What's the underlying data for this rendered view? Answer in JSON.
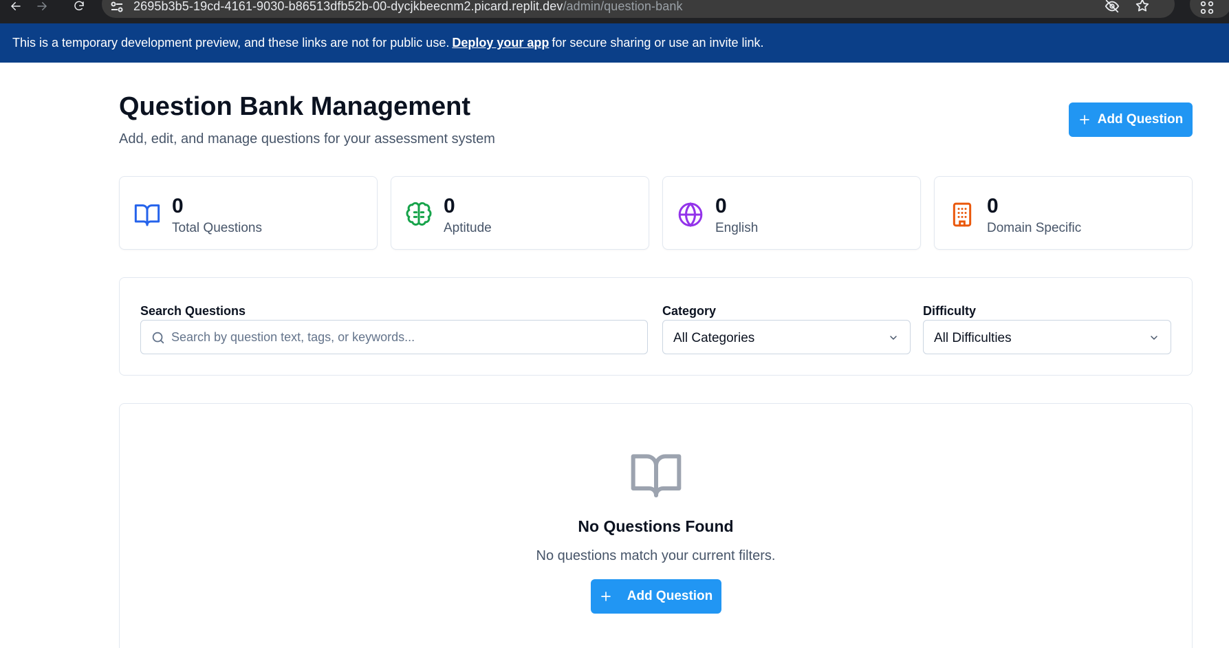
{
  "browser": {
    "url_host": "2695b3b5-19cd-4161-9030-b86513dfb52b-00-dycjkbeecnm2.picard.replit.dev",
    "url_path": "/admin/question-bank"
  },
  "banner": {
    "text_before": "This is a temporary development preview, and these links are not for public use.",
    "link_text": "Deploy your app",
    "text_after": "for secure sharing or use an invite link."
  },
  "header": {
    "title": "Question Bank Management",
    "subtitle": "Add, edit, and manage questions for your assessment system",
    "add_button_label": "Add Question"
  },
  "stats": [
    {
      "value": "0",
      "label": "Total Questions",
      "icon": "book-open-icon",
      "color": "#2563eb"
    },
    {
      "value": "0",
      "label": "Aptitude",
      "icon": "brain-icon",
      "color": "#16a34a"
    },
    {
      "value": "0",
      "label": "English",
      "icon": "globe-icon",
      "color": "#9333ea"
    },
    {
      "value": "0",
      "label": "Domain Specific",
      "icon": "building-icon",
      "color": "#ea580c"
    }
  ],
  "filters": {
    "search_label": "Search Questions",
    "search_placeholder": "Search by question text, tags, or keywords...",
    "category_label": "Category",
    "category_value": "All Categories",
    "difficulty_label": "Difficulty",
    "difficulty_value": "All Difficulties"
  },
  "empty_state": {
    "title": "No Questions Found",
    "message": "No questions match your current filters.",
    "button_label": "Add Question"
  },
  "colors": {
    "primary": "#2196f3",
    "banner_bg": "#0b3f88",
    "chrome_bg": "#202124"
  }
}
